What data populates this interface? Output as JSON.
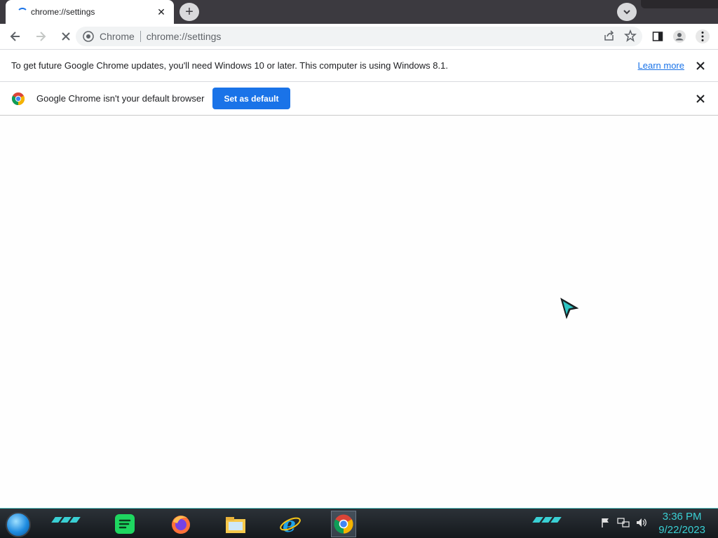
{
  "browser": {
    "tab": {
      "title": "chrome://settings",
      "close_glyph": "✕"
    },
    "new_tab_glyph": "+",
    "omnibox": {
      "chip": "Chrome",
      "url": "chrome://settings"
    }
  },
  "infobars": {
    "update": {
      "message": "To get future Google Chrome updates, you'll need Windows 10 or later. This computer is using Windows 8.1.",
      "link": "Learn more"
    },
    "default_browser": {
      "message": "Google Chrome isn't your default browser",
      "button": "Set as default"
    }
  },
  "taskbar": {
    "apps": [
      "spotify-icon",
      "firefox-icon",
      "file-explorer-icon",
      "internet-explorer-icon",
      "chrome-icon"
    ],
    "clock": {
      "time": "3:36 PM",
      "date": "9/22/2023"
    }
  },
  "colors": {
    "accent": "#1a73e8",
    "tabstrip": "#3c3a40",
    "taskbar_accent": "#3ad0d4"
  }
}
